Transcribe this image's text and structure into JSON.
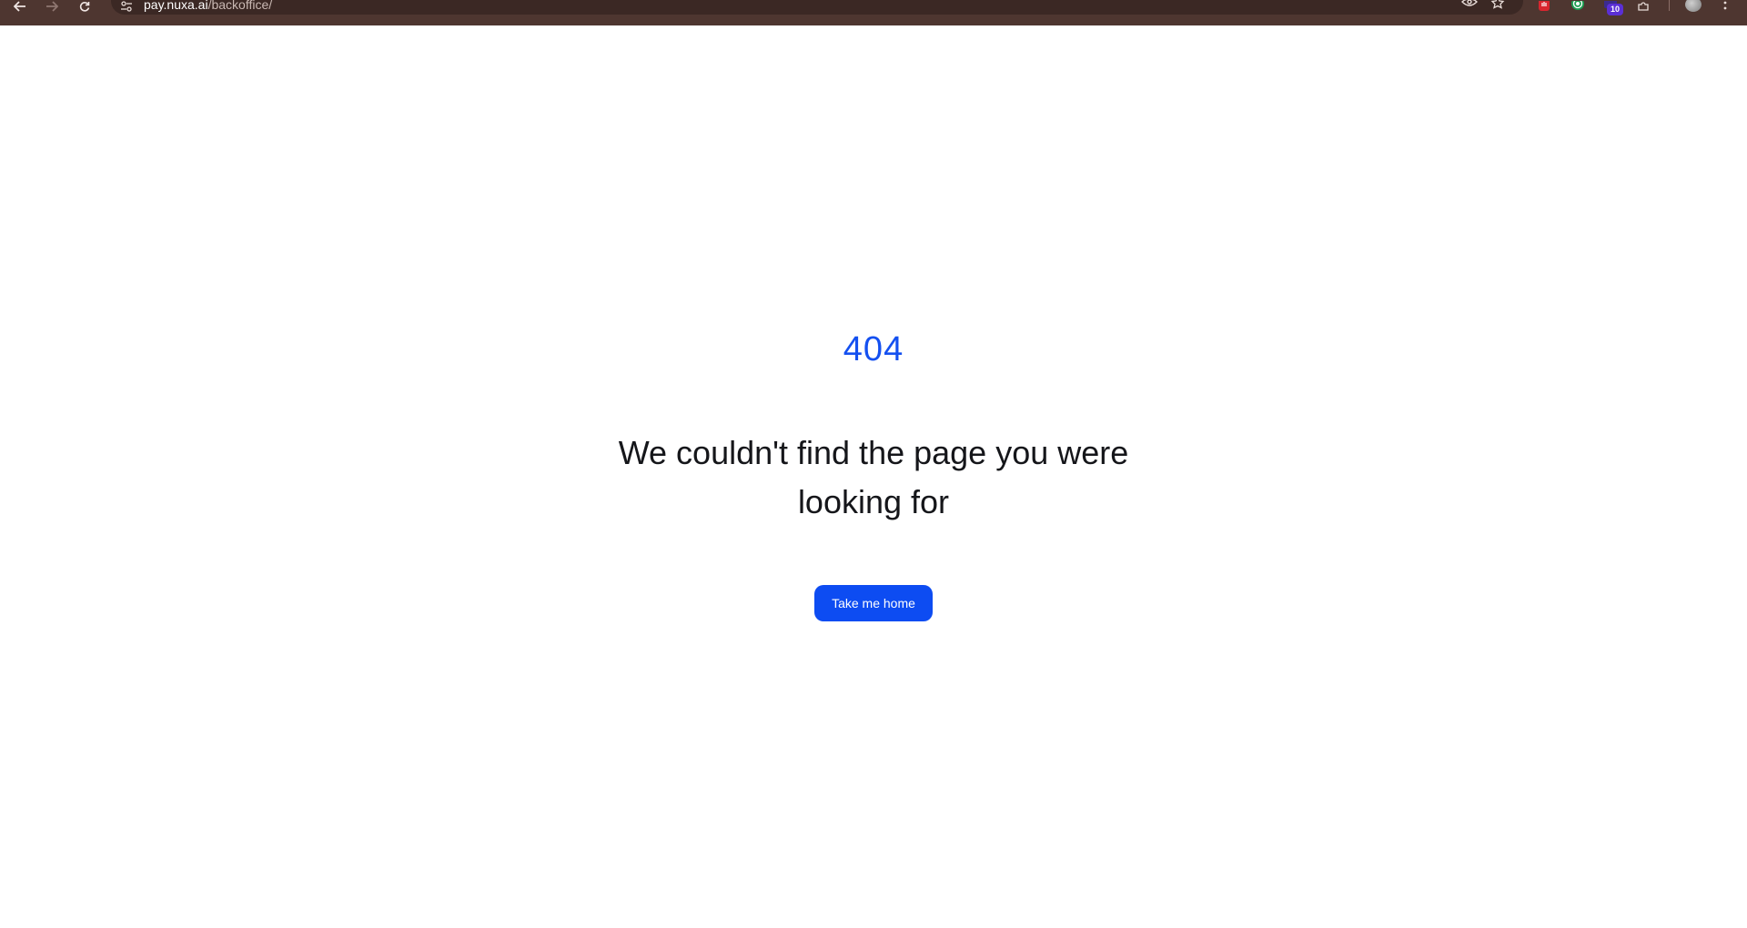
{
  "browser": {
    "url_host": "pay.nuxa.ai",
    "url_path": "/backoffice/",
    "extension_badge_count": "10",
    "icons": {
      "back": "back-arrow-icon",
      "forward": "forward-arrow-icon",
      "reload": "reload-icon",
      "site_info": "site-settings-icon",
      "eye": "eye-icon",
      "bookmark": "star-icon",
      "ext1": "red-hand-extension-icon",
      "ext2": "green-target-extension-icon",
      "ext3": "purple-extension-icon",
      "extensions": "puzzle-icon",
      "profile": "profile-avatar",
      "menu": "kebab-menu-icon"
    }
  },
  "page": {
    "error_code": "404",
    "message": "We couldn't find the page you were looking for",
    "home_button_label": "Take me home"
  },
  "colors": {
    "accent": "#1450f0",
    "button_bg": "#0d4cf2",
    "chrome_bar": "#4e3630",
    "text": "#15161a"
  }
}
